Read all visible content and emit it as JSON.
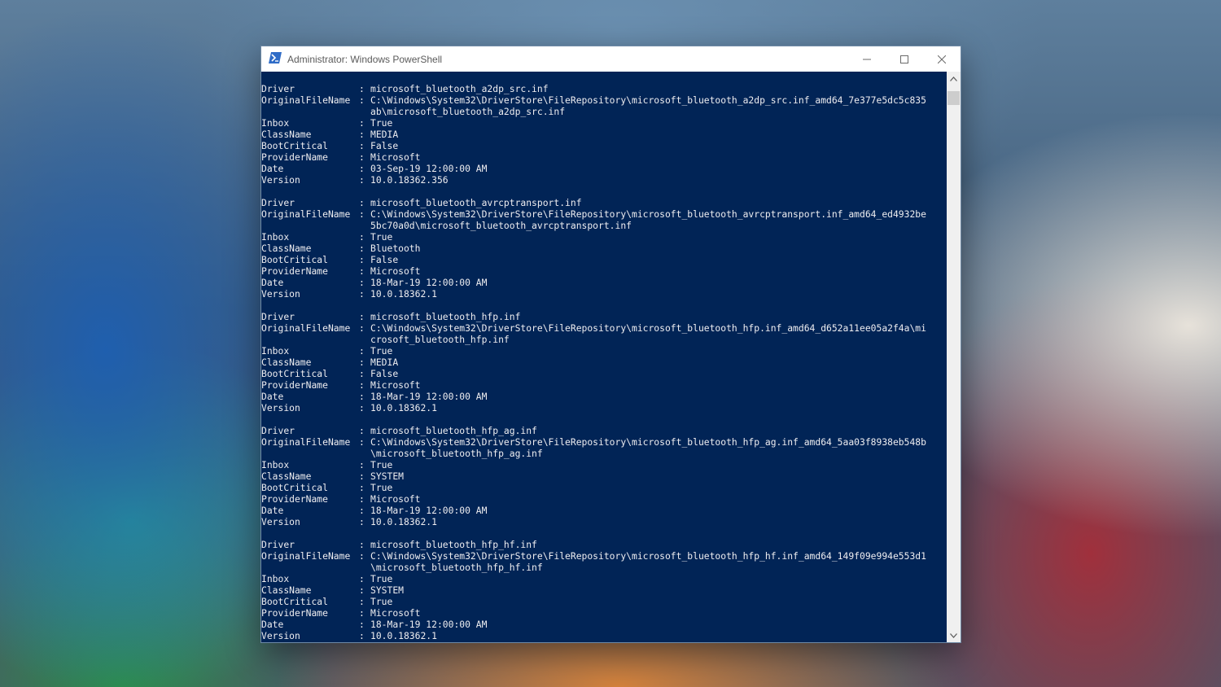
{
  "window": {
    "title": "Administrator: Windows PowerShell",
    "icons": {
      "app": "powershell-icon",
      "minimize": "minimize-icon",
      "maximize": "maximize-icon",
      "close": "close-icon"
    },
    "colors": {
      "console_bg": "#012456",
      "console_fg": "#eeedf0",
      "titlebar_bg": "#ffffff"
    }
  },
  "console": {
    "separator": ":",
    "entries": [
      {
        "driver": "microsoft_bluetooth_a2dp_src.inf",
        "original_file_name": [
          "C:\\Windows\\System32\\DriverStore\\FileRepository\\microsoft_bluetooth_a2dp_src.inf_amd64_7e377e5dc5c835",
          "ab\\microsoft_bluetooth_a2dp_src.inf"
        ],
        "inbox": "True",
        "class_name": "MEDIA",
        "boot_critical": "False",
        "provider_name": "Microsoft",
        "date": "03-Sep-19 12:00:00 AM",
        "version": "10.0.18362.356"
      },
      {
        "driver": "microsoft_bluetooth_avrcptransport.inf",
        "original_file_name": [
          "C:\\Windows\\System32\\DriverStore\\FileRepository\\microsoft_bluetooth_avrcptransport.inf_amd64_ed4932be",
          "5bc70a0d\\microsoft_bluetooth_avrcptransport.inf"
        ],
        "inbox": "True",
        "class_name": "Bluetooth",
        "boot_critical": "False",
        "provider_name": "Microsoft",
        "date": "18-Mar-19 12:00:00 AM",
        "version": "10.0.18362.1"
      },
      {
        "driver": "microsoft_bluetooth_hfp.inf",
        "original_file_name": [
          "C:\\Windows\\System32\\DriverStore\\FileRepository\\microsoft_bluetooth_hfp.inf_amd64_d652a11ee05a2f4a\\mi",
          "crosoft_bluetooth_hfp.inf"
        ],
        "inbox": "True",
        "class_name": "MEDIA",
        "boot_critical": "False",
        "provider_name": "Microsoft",
        "date": "18-Mar-19 12:00:00 AM",
        "version": "10.0.18362.1"
      },
      {
        "driver": "microsoft_bluetooth_hfp_ag.inf",
        "original_file_name": [
          "C:\\Windows\\System32\\DriverStore\\FileRepository\\microsoft_bluetooth_hfp_ag.inf_amd64_5aa03f8938eb548b",
          "\\microsoft_bluetooth_hfp_ag.inf"
        ],
        "inbox": "True",
        "class_name": "SYSTEM",
        "boot_critical": "True",
        "provider_name": "Microsoft",
        "date": "18-Mar-19 12:00:00 AM",
        "version": "10.0.18362.1"
      },
      {
        "driver": "microsoft_bluetooth_hfp_hf.inf",
        "original_file_name": [
          "C:\\Windows\\System32\\DriverStore\\FileRepository\\microsoft_bluetooth_hfp_hf.inf_amd64_149f09e994e553d1",
          "\\microsoft_bluetooth_hfp_hf.inf"
        ],
        "inbox": "True",
        "class_name": "SYSTEM",
        "boot_critical": "True",
        "provider_name": "Microsoft",
        "date": "18-Mar-19 12:00:00 AM",
        "version": "10.0.18362.1"
      }
    ],
    "labels": {
      "driver": "Driver",
      "original_file_name": "OriginalFileName",
      "inbox": "Inbox",
      "class_name": "ClassName",
      "boot_critical": "BootCritical",
      "provider_name": "ProviderName",
      "date": "Date",
      "version": "Version"
    }
  },
  "scrollbar": {
    "icons": {
      "up": "scroll-up-arrow-icon",
      "down": "scroll-down-arrow-icon"
    }
  }
}
